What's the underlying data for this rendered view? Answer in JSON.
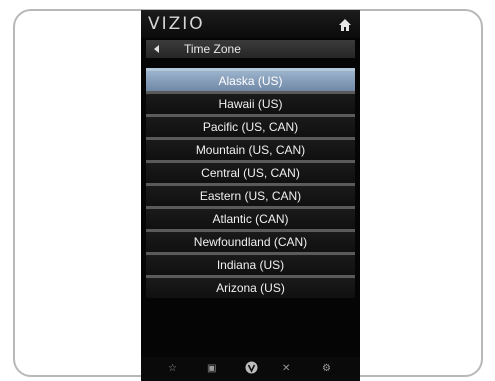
{
  "header": {
    "logo_text": "VIZIO",
    "home_icon": "home-icon"
  },
  "submenu": {
    "back_icon": "back-arrow-icon",
    "title": "Time Zone"
  },
  "time_zones": {
    "items": [
      {
        "label": "Alaska (US)",
        "selected": true
      },
      {
        "label": "Hawaii (US)",
        "selected": false
      },
      {
        "label": "Pacific (US, CAN)",
        "selected": false
      },
      {
        "label": "Mountain (US, CAN)",
        "selected": false
      },
      {
        "label": "Central (US, CAN)",
        "selected": false
      },
      {
        "label": "Eastern (US, CAN)",
        "selected": false
      },
      {
        "label": "Atlantic (CAN)",
        "selected": false
      },
      {
        "label": "Newfoundland (CAN)",
        "selected": false
      },
      {
        "label": "Indiana (US)",
        "selected": false
      },
      {
        "label": "Arizona (US)",
        "selected": false
      }
    ]
  },
  "footer": {
    "icons": [
      "star-icon",
      "widget-icon",
      "vizio-v-icon",
      "close-icon",
      "settings-icon"
    ]
  },
  "colors": {
    "selected_bg": "#7f97b3",
    "screen_bg": "#050505"
  }
}
